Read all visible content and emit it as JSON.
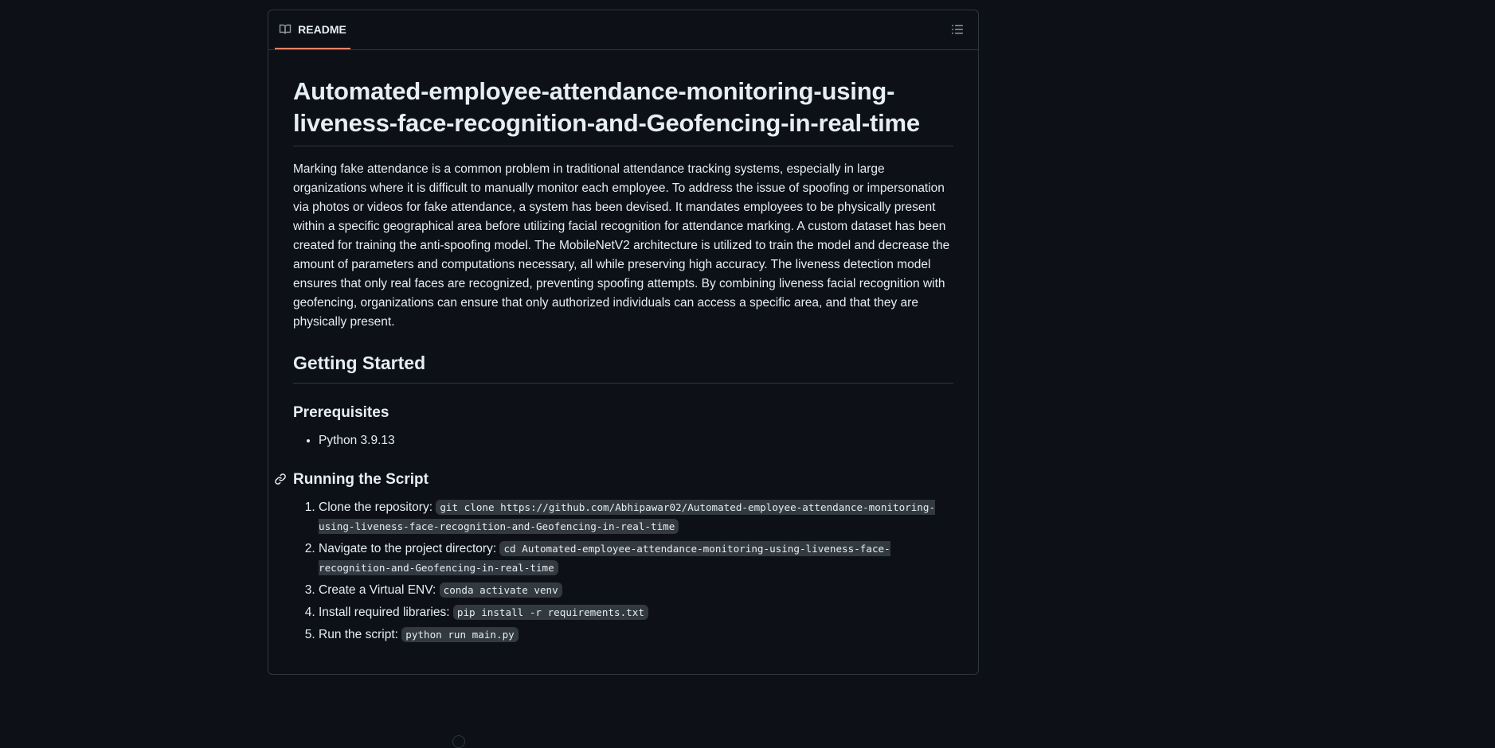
{
  "readme": {
    "tab_label": "README"
  },
  "article": {
    "title": "Automated-employee-attendance-monitoring-using-liveness-face-recognition-and-Geofencing-in-real-time",
    "intro": "Marking fake attendance is a common problem in traditional attendance tracking systems, especially in large organizations where it is difficult to manually monitor each employee. To address the issue of spoofing or impersonation via photos or videos for fake attendance, a system has been devised. It mandates employees to be physically present within a specific geographical area before utilizing facial recognition for attendance marking. A custom dataset has been created for training the anti-spoofing model. The MobileNetV2 architecture is utilized to train the model and decrease the amount of parameters and computations necessary, all while preserving high accuracy. The liveness detection model ensures that only real faces are recognized, preventing spoofing attempts. By combining liveness facial recognition with geofencing, organizations can ensure that only authorized individuals can access a specific area, and that they are physically present.",
    "getting_started": "Getting Started",
    "prerequisites": {
      "heading": "Prerequisites",
      "items": [
        "Python 3.9.13"
      ]
    },
    "running": {
      "heading": "Running the Script",
      "steps": [
        {
          "text": "Clone the repository: ",
          "code": "git clone https://github.com/Abhipawar02/Automated-employee-attendance-monitoring-using-liveness-face-recognition-and-Geofencing-in-real-time"
        },
        {
          "text": "Navigate to the project directory: ",
          "code": "cd Automated-employee-attendance-monitoring-using-liveness-face-recognition-and-Geofencing-in-real-time"
        },
        {
          "text": "Create a Virtual ENV: ",
          "code": "conda activate venv"
        },
        {
          "text": "Install required libraries: ",
          "code": "pip install -r requirements.txt"
        },
        {
          "text": "Run the script: ",
          "code": "python run main.py"
        }
      ]
    }
  }
}
